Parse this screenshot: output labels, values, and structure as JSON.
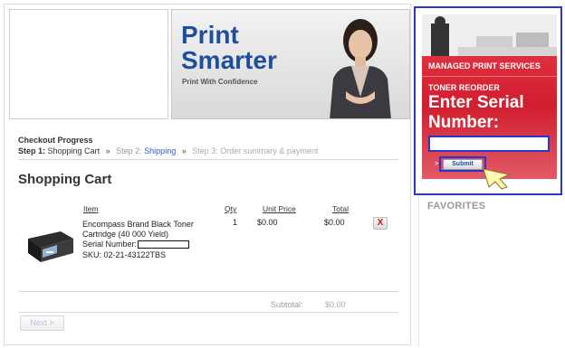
{
  "banner": {
    "line1": "Print",
    "line2": "Smarter",
    "tagline": "Print With Confidence"
  },
  "checkout": {
    "title": "Checkout Progress",
    "step1_prefix": "Step 1:",
    "step1_label": "Shopping Cart",
    "separator": "»",
    "step2_prefix": "Step 2:",
    "step2_label": "Shipping",
    "step3_prefix": "Step 3:",
    "step3_label": "Order summary & payment"
  },
  "cart": {
    "title": "Shopping Cart",
    "columns": {
      "item": "Item",
      "qty": "Qty",
      "unit_price": "Unit Price",
      "total": "Total"
    },
    "items": [
      {
        "name_line1": "Encompass Brand Black Toner",
        "name_line2": "Cartridge (40 000 Yield)",
        "serial_label": "Serial Number:",
        "sku": "SKU: 02-21-43122TBS",
        "qty": "1",
        "unit_price": "$0.00",
        "total": "$0.00",
        "delete_label": "X"
      }
    ],
    "subtotal_label": "Subtotal:",
    "subtotal_value": "$0.00",
    "next_label": "Next >"
  },
  "promo": {
    "heading": "MANAGED PRINT SERVICES",
    "subheading": "TONER REORDER",
    "title_line1": "Enter Serial",
    "title_line2": "Number:",
    "serial_value": "",
    "submit_label": "Submit",
    "arrow": ">"
  },
  "sidebar": {
    "favorites_label": "FAVORITES"
  },
  "colors": {
    "brand_blue": "#1e4f9e",
    "promo_red": "#d21d2e",
    "highlight_blue": "#2a34d0",
    "delete_red": "#cc1111"
  }
}
